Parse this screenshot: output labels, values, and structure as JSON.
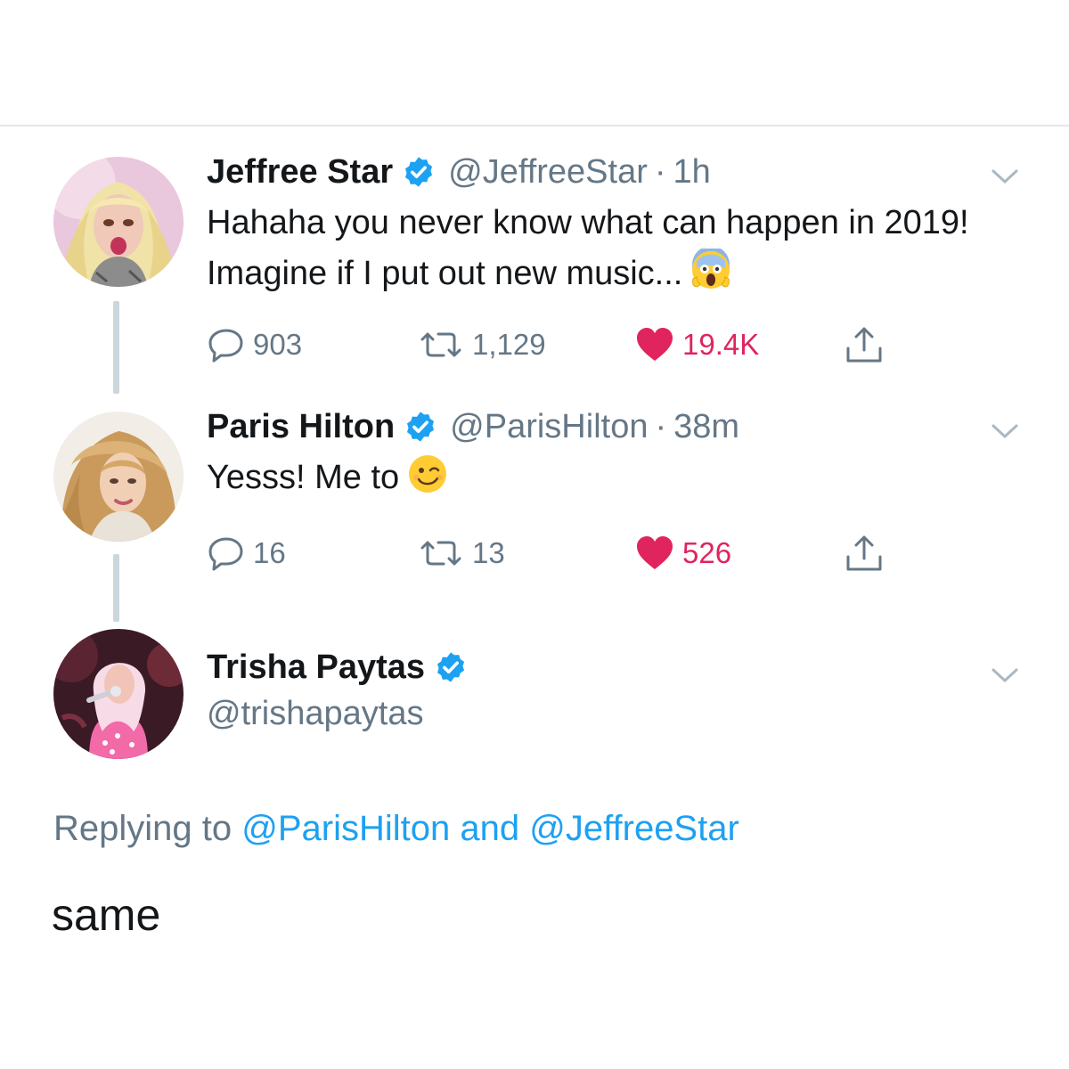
{
  "tweets": [
    {
      "name": "Jeffree Star",
      "handle": "@JeffreeStar",
      "separator": "·",
      "time": "1h",
      "text": "Hahaha you never know what can happen in 2019! Imagine if I put out new music...",
      "emoji": "face-screaming-in-fear",
      "replies": "903",
      "retweets": "1,129",
      "likes": "19.4K"
    },
    {
      "name": "Paris Hilton",
      "handle": "@ParisHilton",
      "separator": "·",
      "time": "38m",
      "text": "Yesss! Me to",
      "emoji": "winking-face",
      "replies": "16",
      "retweets": "13",
      "likes": "526"
    }
  ],
  "main_tweet": {
    "name": "Trisha Paytas",
    "handle": "@trishapaytas",
    "replying_prefix": "Replying to",
    "mention_1": "@ParisHilton",
    "replying_and": "and",
    "mention_2": "@JeffreeStar",
    "text": "same"
  },
  "colors": {
    "text": "#14171a",
    "secondary": "#657786",
    "link": "#1da1f2",
    "like": "#e0245e",
    "verified": "#1da1f2",
    "divider": "#e1e8ed",
    "thread_line": "#ccd6dd"
  },
  "icons": {
    "verified": "verified-badge-icon",
    "reply": "reply-icon",
    "retweet": "retweet-icon",
    "like": "heart-icon",
    "share": "share-icon",
    "menu": "chevron-down-icon"
  }
}
